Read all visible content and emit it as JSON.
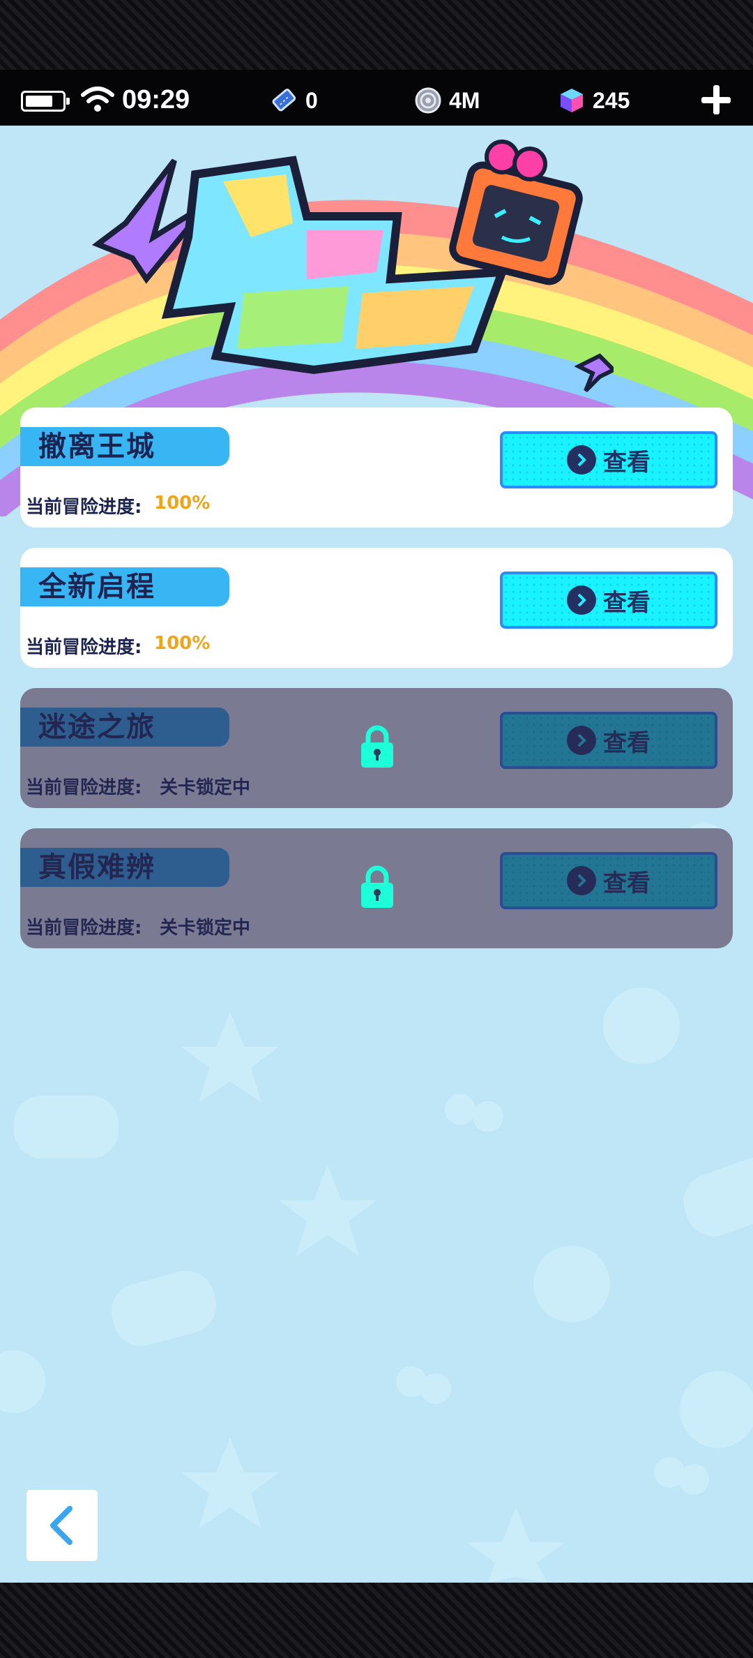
{
  "status_bar": {
    "time": "09:29",
    "tickets": "0",
    "coins": "4M",
    "gems": "245"
  },
  "colors": {
    "accent_cyan": "#1df0ff",
    "tag_blue": "#38b6f4",
    "progress_orange": "#f2a418",
    "navy": "#1c2350"
  },
  "levels": [
    {
      "title": "撤离王城",
      "progress_label": "当前冒险进度:",
      "progress": "100%",
      "button": "查看",
      "locked": false
    },
    {
      "title": "全新启程",
      "progress_label": "当前冒险进度:",
      "progress": "100%",
      "button": "查看",
      "locked": false
    },
    {
      "title": "迷途之旅",
      "progress_label": "当前冒险进度:",
      "progress": "关卡锁定中",
      "button": "查看",
      "locked": true
    },
    {
      "title": "真假难辨",
      "progress_label": "当前冒险进度:",
      "progress": "关卡锁定中",
      "button": "查看",
      "locked": true
    }
  ],
  "icons": {
    "back": "chevron-left-icon",
    "lock": "lock-icon",
    "add": "plus-icon"
  }
}
